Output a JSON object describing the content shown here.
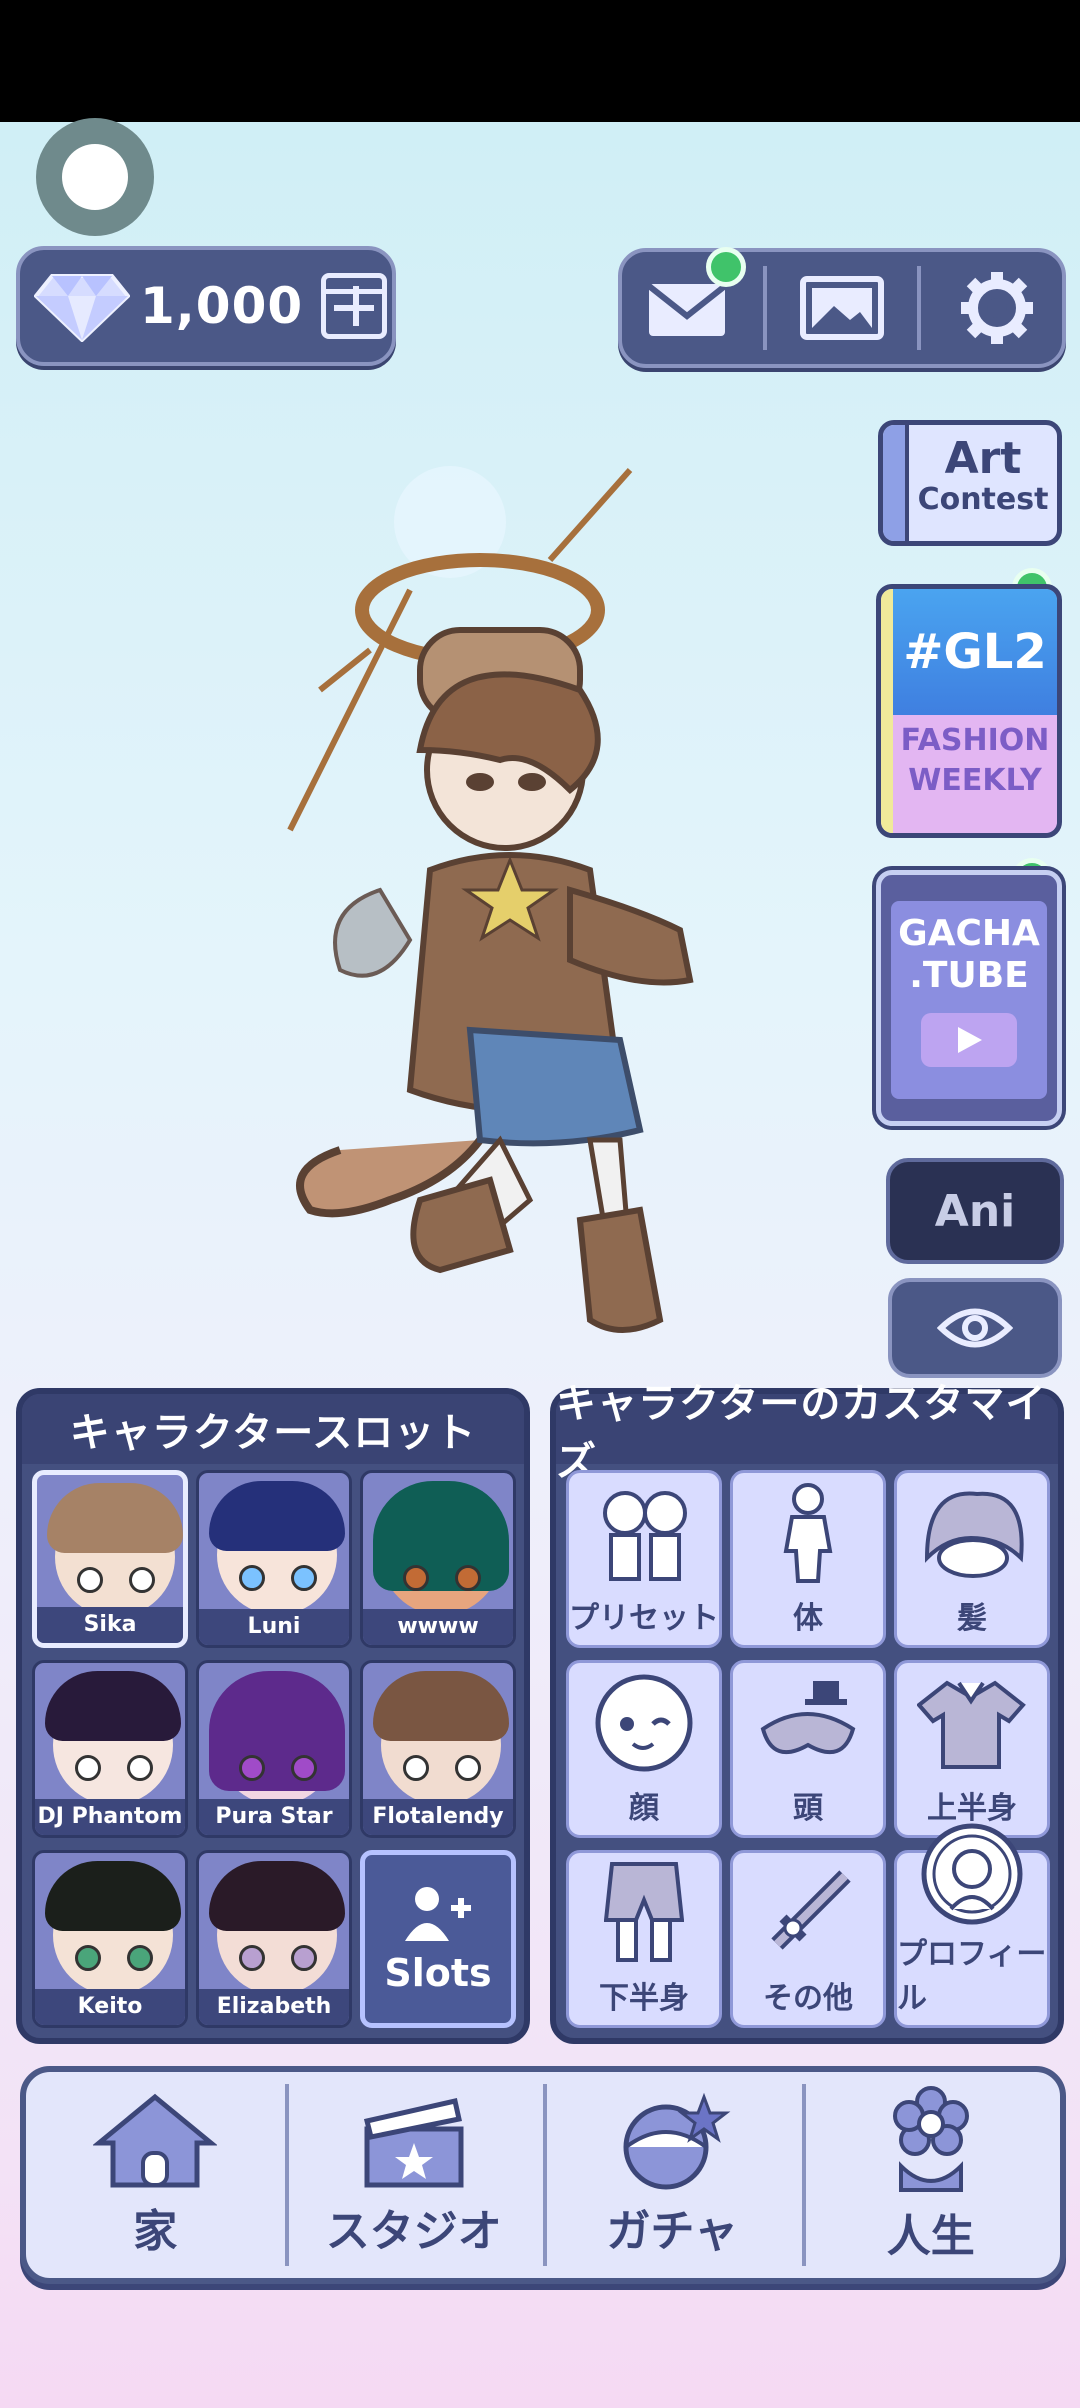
{
  "currency": {
    "gems": "1,000"
  },
  "side": {
    "art_contest": {
      "line1": "Art",
      "line2": "Contest"
    },
    "gl2": {
      "title": "#GL2",
      "line1": "FASHION",
      "line2": "WEEKLY"
    },
    "tube": {
      "line1": "GACHA",
      "line2": ".TUBE"
    },
    "ani": "Ani"
  },
  "slots_panel": {
    "title": "キャラクタースロット",
    "slots": [
      {
        "name": "Sika"
      },
      {
        "name": "Luni"
      },
      {
        "name": "wwww"
      },
      {
        "name": "DJ Phantom"
      },
      {
        "name": "Pura Star"
      },
      {
        "name": "Flotalendy"
      },
      {
        "name": "Keito"
      },
      {
        "name": "Elizabeth"
      }
    ],
    "add_label": "Slots"
  },
  "customize_panel": {
    "title": "キャラクターのカスタマイズ",
    "items": [
      "プリセット",
      "体",
      "髪",
      "顔",
      "頭",
      "上半身",
      "下半身",
      "その他",
      "プロフィール"
    ]
  },
  "nav": [
    "家",
    "スタジオ",
    "ガチャ",
    "人生"
  ],
  "colors": {
    "panel": "#445080",
    "accent": "#40c36a",
    "nav_text": "#3c4678"
  }
}
